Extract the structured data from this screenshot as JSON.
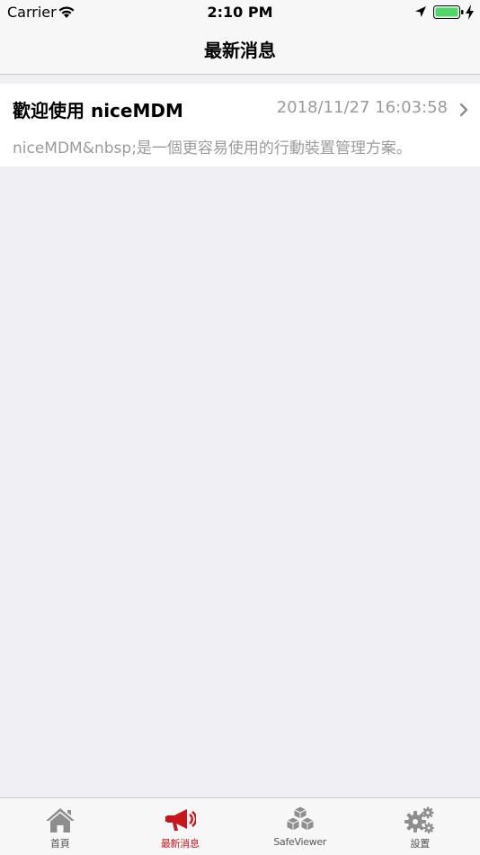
{
  "status_bar": {
    "carrier": "Carrier",
    "time": "2:10 PM",
    "icons": [
      "wifi-icon",
      "location-arrow-icon",
      "battery-icon",
      "charging-icon"
    ]
  },
  "nav": {
    "title": "最新消息"
  },
  "messages": [
    {
      "title": "歡迎使用 niceMDM",
      "date": "2018/11/27 16:03:58",
      "preview": "niceMDM&nbsp;是一個更容易使用的行動裝置管理方案。"
    }
  ],
  "tabs": [
    {
      "label": "首頁",
      "icon": "home-icon",
      "active": false
    },
    {
      "label": "最新消息",
      "icon": "megaphone-icon",
      "active": true
    },
    {
      "label": "SafeViewer",
      "icon": "cubes-icon",
      "active": false
    },
    {
      "label": "設置",
      "icon": "gears-icon",
      "active": false
    }
  ],
  "colors": {
    "accent": "#c8161d",
    "background": "#efeff4",
    "bar": "#f7f7f7",
    "secondary_text": "#9b9b9b",
    "battery": "#4cd964",
    "icon_gray": "#8e8e8e"
  }
}
